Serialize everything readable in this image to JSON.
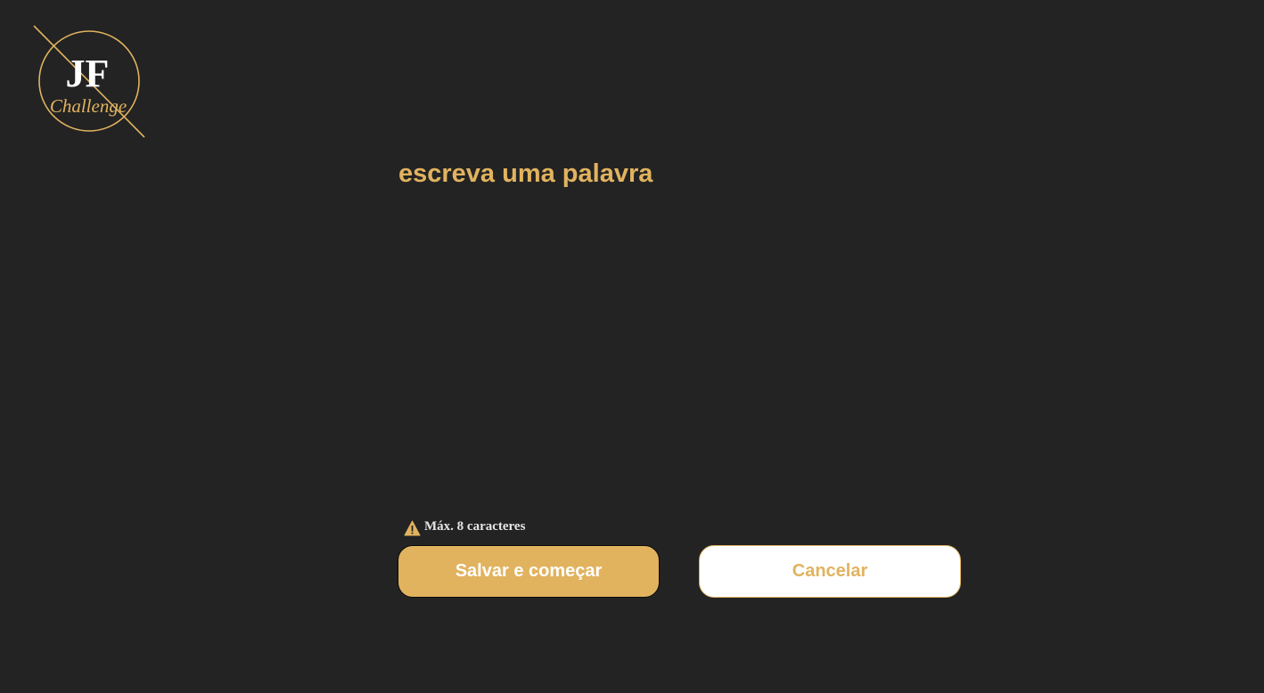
{
  "logo": {
    "monogram": "JF",
    "tagline": "Challenge",
    "accent_color": "#e1b35f",
    "monogram_color": "#ffffff"
  },
  "editor": {
    "placeholder": "escreva uma palavra",
    "value": ""
  },
  "hint": {
    "icon": "warning-icon",
    "text": "Máx. 8 caracteres"
  },
  "actions": {
    "save_label": "Salvar e começar",
    "cancel_label": "Cancelar"
  },
  "colors": {
    "background": "#232323",
    "accent": "#e1b35f",
    "white": "#ffffff"
  }
}
